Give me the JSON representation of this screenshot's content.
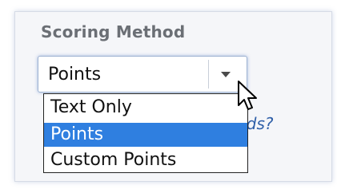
{
  "section": {
    "title": "Scoring Method"
  },
  "select": {
    "current_value": "Points",
    "arrow_icon": "dropdown-arrow-icon"
  },
  "dropdown": {
    "options": [
      "Text Only",
      "Points",
      "Custom Points"
    ],
    "selected": "Points"
  },
  "help_link": {
    "visible_text": "thods?"
  },
  "colors": {
    "selection": "#2f7fe0",
    "heading": "#6b6f75",
    "link": "#2f5fa8",
    "focus_outline": "#9fb3d1"
  }
}
